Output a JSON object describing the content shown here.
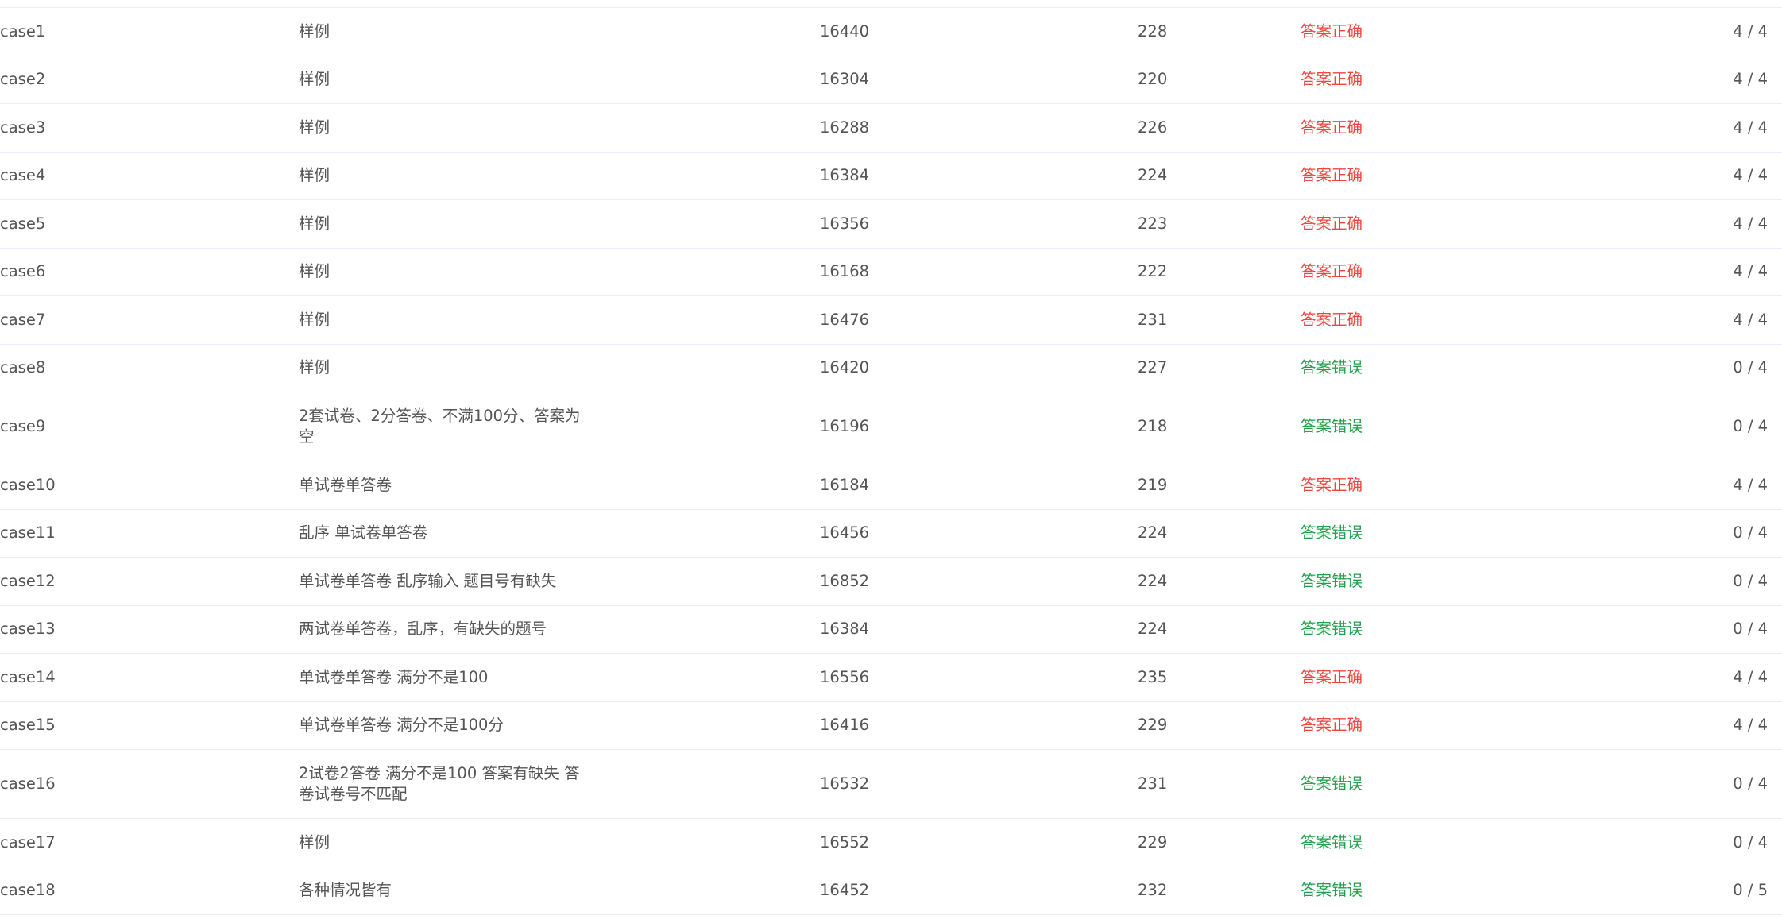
{
  "colors": {
    "correct": "#f0453f",
    "wrong": "#1fa04a",
    "text": "#555555",
    "divider": "#ebeef5"
  },
  "rows": [
    {
      "name": "case1",
      "desc": "样例",
      "time": "16440",
      "mem": "228",
      "result": "答案正确",
      "status": "ok",
      "score": "4 / 4"
    },
    {
      "name": "case2",
      "desc": "样例",
      "time": "16304",
      "mem": "220",
      "result": "答案正确",
      "status": "ok",
      "score": "4 / 4"
    },
    {
      "name": "case3",
      "desc": "样例",
      "time": "16288",
      "mem": "226",
      "result": "答案正确",
      "status": "ok",
      "score": "4 / 4"
    },
    {
      "name": "case4",
      "desc": "样例",
      "time": "16384",
      "mem": "224",
      "result": "答案正确",
      "status": "ok",
      "score": "4 / 4"
    },
    {
      "name": "case5",
      "desc": "样例",
      "time": "16356",
      "mem": "223",
      "result": "答案正确",
      "status": "ok",
      "score": "4 / 4"
    },
    {
      "name": "case6",
      "desc": "样例",
      "time": "16168",
      "mem": "222",
      "result": "答案正确",
      "status": "ok",
      "score": "4 / 4"
    },
    {
      "name": "case7",
      "desc": "样例",
      "time": "16476",
      "mem": "231",
      "result": "答案正确",
      "status": "ok",
      "score": "4 / 4"
    },
    {
      "name": "case8",
      "desc": "样例",
      "time": "16420",
      "mem": "227",
      "result": "答案错误",
      "status": "bad",
      "score": "0 / 4"
    },
    {
      "name": "case9",
      "desc": "2套试卷、2分答卷、不满100分、答案为空",
      "time": "16196",
      "mem": "218",
      "result": "答案错误",
      "status": "bad",
      "score": "0 / 4"
    },
    {
      "name": "case10",
      "desc": "单试卷单答卷",
      "time": "16184",
      "mem": "219",
      "result": "答案正确",
      "status": "ok",
      "score": "4 / 4"
    },
    {
      "name": "case11",
      "desc": "乱序 单试卷单答卷",
      "time": "16456",
      "mem": "224",
      "result": "答案错误",
      "status": "bad",
      "score": "0 / 4"
    },
    {
      "name": "case12",
      "desc": "单试卷单答卷 乱序输入 题目号有缺失",
      "time": "16852",
      "mem": "224",
      "result": "答案错误",
      "status": "bad",
      "score": "0 / 4"
    },
    {
      "name": "case13",
      "desc": "两试卷单答卷，乱序，有缺失的题号",
      "time": "16384",
      "mem": "224",
      "result": "答案错误",
      "status": "bad",
      "score": "0 / 4"
    },
    {
      "name": "case14",
      "desc": "单试卷单答卷 满分不是100",
      "time": "16556",
      "mem": "235",
      "result": "答案正确",
      "status": "ok",
      "score": "4 / 4"
    },
    {
      "name": "case15",
      "desc": "单试卷单答卷 满分不是100分",
      "time": "16416",
      "mem": "229",
      "result": "答案正确",
      "status": "ok",
      "score": "4 / 4"
    },
    {
      "name": "case16",
      "desc": "2试卷2答卷 满分不是100 答案有缺失 答卷试卷号不匹配",
      "time": "16532",
      "mem": "231",
      "result": "答案错误",
      "status": "bad",
      "score": "0 / 4"
    },
    {
      "name": "case17",
      "desc": "样例",
      "time": "16552",
      "mem": "229",
      "result": "答案错误",
      "status": "bad",
      "score": "0 / 4"
    },
    {
      "name": "case18",
      "desc": "各种情况皆有",
      "time": "16452",
      "mem": "232",
      "result": "答案错误",
      "status": "bad",
      "score": "0 / 5"
    }
  ]
}
